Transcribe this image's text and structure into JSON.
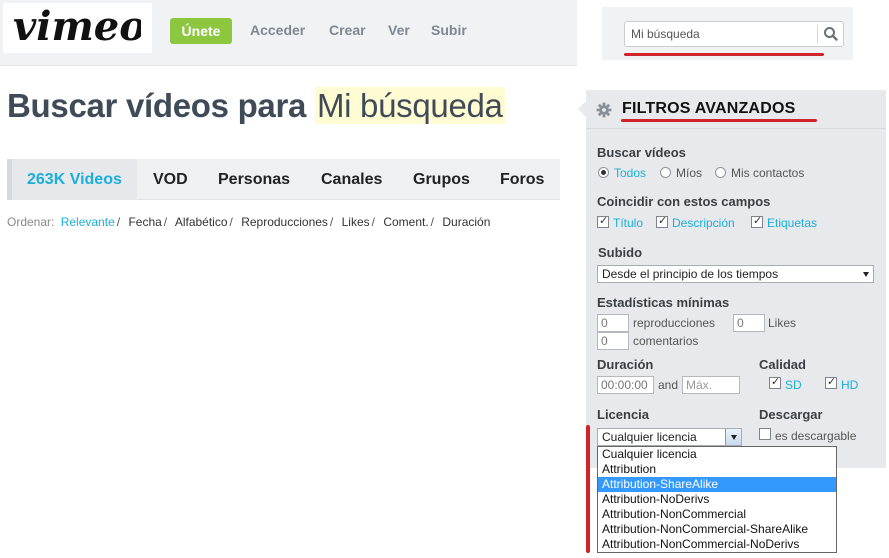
{
  "header": {
    "logo_text": "vimeo",
    "join_label": "Únete",
    "nav": [
      "Acceder",
      "Crear",
      "Ver",
      "Subir"
    ]
  },
  "search": {
    "value": "Mi búsqueda",
    "icon": "search-icon"
  },
  "page": {
    "title_prefix": "Buscar vídeos para",
    "title_query": "Mi búsqueda"
  },
  "tabs": [
    {
      "label": "263K Videos",
      "active": true
    },
    {
      "label": "VOD",
      "active": false
    },
    {
      "label": "Personas",
      "active": false
    },
    {
      "label": "Canales",
      "active": false
    },
    {
      "label": "Grupos",
      "active": false
    },
    {
      "label": "Foros",
      "active": false
    }
  ],
  "sort": {
    "label": "Ordenar:",
    "options": [
      "Relevante",
      "Fecha",
      "Alfabético",
      "Reproducciones",
      "Likes",
      "Coment.",
      "Duración"
    ],
    "active": "Relevante"
  },
  "filters": {
    "title": "FILTROS AVANZADOS",
    "icon": "gear-icon",
    "search_videos": {
      "label": "Buscar vídeos",
      "options": [
        "Todos",
        "Míos",
        "Mis contactos"
      ],
      "selected": "Todos"
    },
    "match_fields": {
      "label": "Coincidir con estos campos",
      "options": [
        "Título",
        "Descripción",
        "Etiquetas"
      ]
    },
    "uploaded": {
      "label": "Subido",
      "value": "Desde el principio de los tiempos"
    },
    "min_stats": {
      "label": "Estadísticas mínimas",
      "plays_value": "0",
      "plays_label": "reproducciones",
      "likes_value": "0",
      "likes_label": "Likes",
      "comments_value": "0",
      "comments_label": "comentarios"
    },
    "duration": {
      "label": "Duración",
      "min_value": "00:00:00",
      "and_label": "and",
      "max_placeholder": "Máx."
    },
    "quality": {
      "label": "Calidad",
      "options": [
        "SD",
        "HD"
      ]
    },
    "license": {
      "label": "Licencia",
      "value": "Cualquier licencia",
      "options": [
        "Cualquier licencia",
        "Attribution",
        "Attribution-ShareAlike",
        "Attribution-NoDerivs",
        "Attribution-NonCommercial",
        "Attribution-NonCommercial-ShareAlike",
        "Attribution-NonCommercial-NoDerivs"
      ],
      "highlighted": "Attribution-ShareAlike"
    },
    "download": {
      "label": "Descargar",
      "option": "es descargable"
    }
  },
  "colors": {
    "accent_blue": "#1aafdb",
    "join_green": "#8dc63f",
    "annotation_red": "#d2232a",
    "dropdown_highlight": "#3399ff"
  }
}
